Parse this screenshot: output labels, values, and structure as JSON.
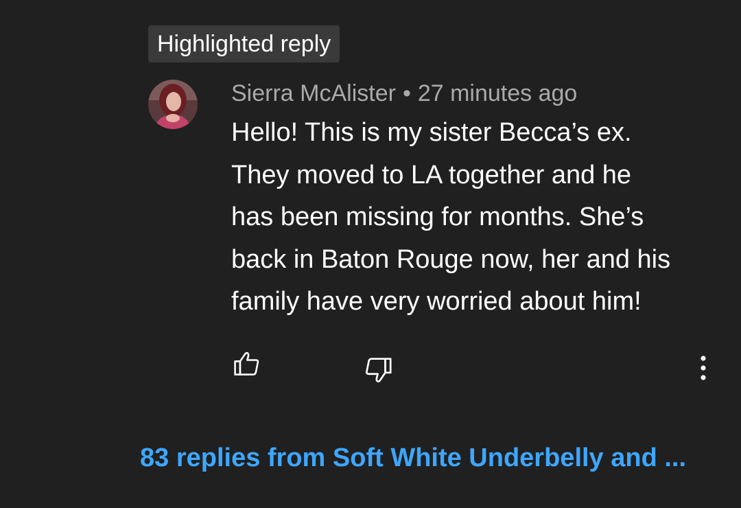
{
  "badge": {
    "label": "Highlighted reply"
  },
  "comment": {
    "author": "Sierra McAlister",
    "separator": "•",
    "time": "27 minutes ago",
    "lines": [
      "Hello! This is my sister Becca’s ex.",
      "They moved to LA together and he",
      "has been missing for months. She’s",
      "back in Baton Rouge now, her and his",
      "family have very worried about him!"
    ]
  },
  "actions": {
    "like_icon": "thumbs-up-icon",
    "dislike_icon": "thumbs-down-icon",
    "more_icon": "more-vertical-icon"
  },
  "replies": {
    "label": "83 replies from Soft White Underbelly and ..."
  },
  "colors": {
    "background": "#202020",
    "badge_bg": "#3a3a3a",
    "meta_text": "#aaaaaa",
    "body_text": "#ffffff",
    "link": "#3ea6ff"
  }
}
